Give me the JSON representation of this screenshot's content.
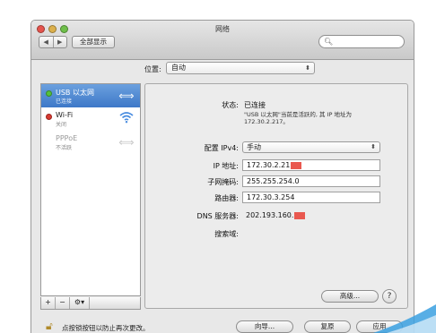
{
  "window": {
    "title": "网络"
  },
  "toolbar": {
    "back": "◀",
    "forward": "▶",
    "show_all": "全部显示",
    "search_placeholder": ""
  },
  "location": {
    "label": "位置:",
    "value": "自动"
  },
  "services": [
    {
      "name": "USB 以太网",
      "status": "已连接",
      "state": "green"
    },
    {
      "name": "Wi-Fi",
      "status": "关闭",
      "state": "red"
    },
    {
      "name": "PPPoE",
      "status": "不活跃",
      "state": "none"
    }
  ],
  "sidebar_controls": {
    "add": "+",
    "remove": "−",
    "gear": "⚙▾"
  },
  "detail": {
    "status_label": "状态:",
    "status_value": "已连接",
    "status_note_1": "\"USB 以太网\"当前是活跃的, 其 IP 地址为",
    "status_note_2": "172.30.2.217。",
    "ipv4_label": "配置 IPv4:",
    "ipv4_value": "手动",
    "ip_label": "IP 地址:",
    "ip_value": "172.30.2.21",
    "mask_label": "子网掩码:",
    "mask_value": "255.255.254.0",
    "router_label": "路由器:",
    "router_value": "172.30.3.254",
    "dns_label": "DNS 服务器:",
    "dns_value": "202.193.160.",
    "search_label": "搜索域:",
    "advanced": "高级...",
    "help": "?"
  },
  "footer": {
    "lock_text": "点按锁按钮以防止再次更改。",
    "assist": "向导...",
    "revert": "复原",
    "apply": "应用"
  },
  "colors": {
    "selection": "#3d78c8",
    "redact": "#e9584f",
    "status_green": "#56c13c",
    "status_red": "#d73b33"
  }
}
